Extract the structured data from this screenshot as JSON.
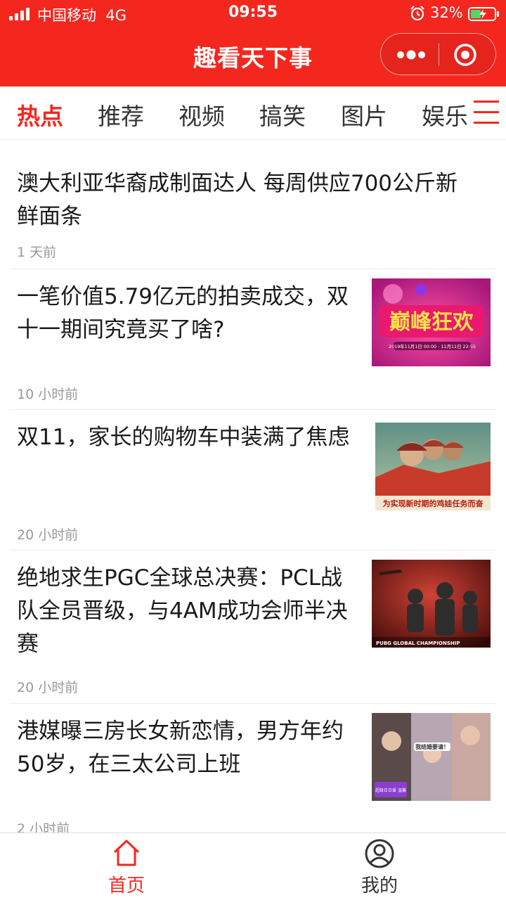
{
  "status_bar": {
    "carrier": "中国移动",
    "network": "4G",
    "time": "09:55",
    "battery": "32%"
  },
  "header": {
    "title": "趣看天下事"
  },
  "tabs": [
    {
      "label": "热点",
      "active": true
    },
    {
      "label": "推荐"
    },
    {
      "label": "视频"
    },
    {
      "label": "搞笑"
    },
    {
      "label": "图片"
    },
    {
      "label": "娱乐"
    }
  ],
  "articles": [
    {
      "line1": "澳大利亚华裔成制面达人 每周供应700公斤新",
      "line2": "鲜面条",
      "line3": "",
      "time": "1 天前",
      "thumb": ""
    },
    {
      "line1": "一笔价值5.79亿元的拍卖成交，双",
      "line2": "十一期间究竟买了啥?",
      "line3": "",
      "time": "10 小时前",
      "thumb": "shopping-festival-banner",
      "thumb_text": "巅峰狂欢",
      "thumb_caption": "2019年11月1日 00:00 - 11月11日 22:55"
    },
    {
      "line1": "双11，家长的购物车中装满了焦虑",
      "line2": "",
      "line3": "",
      "time": "20 小时前",
      "thumb": "propaganda-poster",
      "thumb_caption": "为实现新时期的鸡娃任务而奋"
    },
    {
      "line1": "绝地求生PGC全球总决赛：PCL战",
      "line2": "队全员晋级，与4AM成功会师半决",
      "line3": "赛",
      "time": "20 小时前",
      "thumb": "esports-soldiers",
      "thumb_caption": "PUBG GLOBAL CHAMPIONSHIP"
    },
    {
      "line1": "港媒曝三房长女新恋情，男方年约",
      "line2": "50岁，在三太公司上班",
      "line3": "",
      "time": "2 小时前",
      "thumb": "celebrity-collage",
      "thumb_text1": "我结婚要请！",
      "thumb_text2": "超级日日爱 温馨"
    }
  ],
  "bottom_nav": [
    {
      "label": "首页",
      "icon": "home-icon",
      "active": true
    },
    {
      "label": "我的",
      "icon": "user-icon"
    }
  ],
  "colors": {
    "brand": "#f4271f",
    "text": "#1a1a1a",
    "muted": "#999999"
  }
}
